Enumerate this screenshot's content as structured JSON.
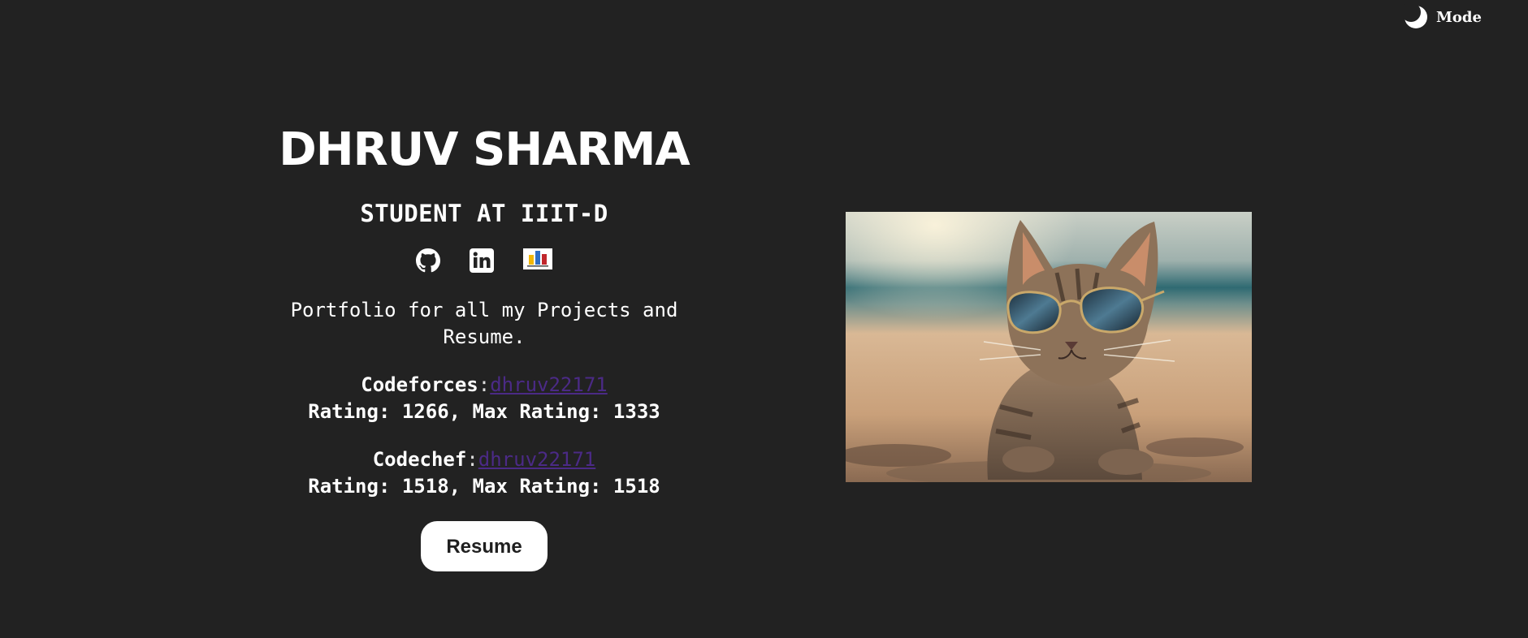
{
  "header": {
    "mode_label": "Mode",
    "mode_icon": "moon-icon"
  },
  "profile": {
    "name": "DHRUV SHARMA",
    "role": "STUDENT AT IIIT-D",
    "socials": [
      {
        "icon": "github-icon"
      },
      {
        "icon": "linkedin-icon"
      },
      {
        "icon": "bar-chart-icon"
      }
    ],
    "description": "Portfolio for all my Projects and Resume.",
    "codeforces": {
      "label": "Codeforces",
      "separator": ":",
      "handle": "dhruv22171",
      "rating_line": "Rating: 1266, Max Rating: 1333"
    },
    "codechef": {
      "label": "Codechef",
      "separator": ":",
      "handle": "dhruv22171",
      "rating_line": "Rating: 1518, Max Rating: 1518"
    },
    "resume_label": "Resume"
  },
  "image": {
    "subject": "cat-with-sunglasses-on-beach"
  },
  "colors": {
    "background": "#222222",
    "text": "#ffffff",
    "link": "#4b2a86",
    "button_bg": "#ffffff"
  }
}
